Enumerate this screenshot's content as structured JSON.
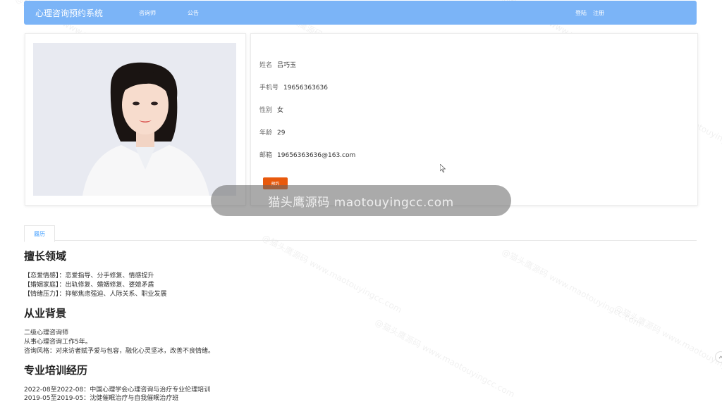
{
  "header": {
    "brand": "心理咨询预约系统",
    "nav": [
      "咨询师",
      "公告"
    ],
    "login": "登陆",
    "register": "注册"
  },
  "profile": {
    "name_label": "姓名",
    "name": "吕巧玉",
    "phone_label": "手机号",
    "phone": "19656363636",
    "gender_label": "性别",
    "gender": "女",
    "age_label": "年龄",
    "age": "29",
    "email_label": "邮箱",
    "email": "19656363636@163.com",
    "book_button": "预约"
  },
  "watermark": "猫头鹰源码 maotouyingcc.com",
  "faint_watermark": "@猫头鹰源码 www.maotouyingcc.com",
  "tab": "履历",
  "sections": {
    "skills_title": "擅长领域",
    "skills": [
      "【恋爱情感】：恋爱指导、分手修复、情感提升",
      "【婚姻家庭】：出轨修复、婚姻修复、婆媳矛盾",
      "【情绪压力】：抑郁焦虑强迫、人际关系、职业发展"
    ],
    "background_title": "从业背景",
    "background": [
      "二级心理咨询师",
      "从事心理咨询工作5年。",
      "咨询风格：对来访者赋予爱与包容，融化心灵坚冰，改善不良情绪。"
    ],
    "training_title": "专业培训经历",
    "training": [
      "2022-08至2022-08：中国心理学会心理咨询与治疗专业伦理培训",
      "2019-05至2019-05：沈健催眠治疗与自我催眠治疗班"
    ]
  },
  "colors": {
    "topbar": "#7bb4f7",
    "book_button": "#e8590c",
    "tab_text": "#409eff"
  }
}
